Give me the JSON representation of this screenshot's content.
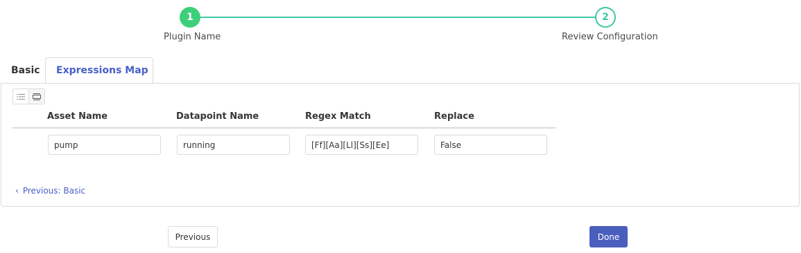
{
  "stepper": {
    "steps": [
      {
        "number": "1",
        "label": "Plugin Name",
        "state": "completed"
      },
      {
        "number": "2",
        "label": "Review Configuration",
        "state": "current"
      }
    ],
    "colors": {
      "completed": "#3ecf7a",
      "line": "#3cc9a3"
    }
  },
  "tabs": [
    {
      "label": "Basic",
      "active": false
    },
    {
      "label": "Expressions Map",
      "active": true
    }
  ],
  "toolbar": {
    "view_icons": [
      "list-view-icon",
      "card-view-icon"
    ]
  },
  "table": {
    "columns": [
      "Asset Name",
      "Datapoint Name",
      "Regex Match",
      "Replace"
    ],
    "rows": [
      [
        "pump",
        "running",
        "[Ff][Aa][Ll][Ss][Ee]",
        "False"
      ]
    ]
  },
  "nav": {
    "previous_link": "Previous: Basic",
    "previous_button": "Previous",
    "done_button": "Done"
  },
  "colors": {
    "accent": "#485fc7",
    "done_bg": "#4a5ebd"
  }
}
